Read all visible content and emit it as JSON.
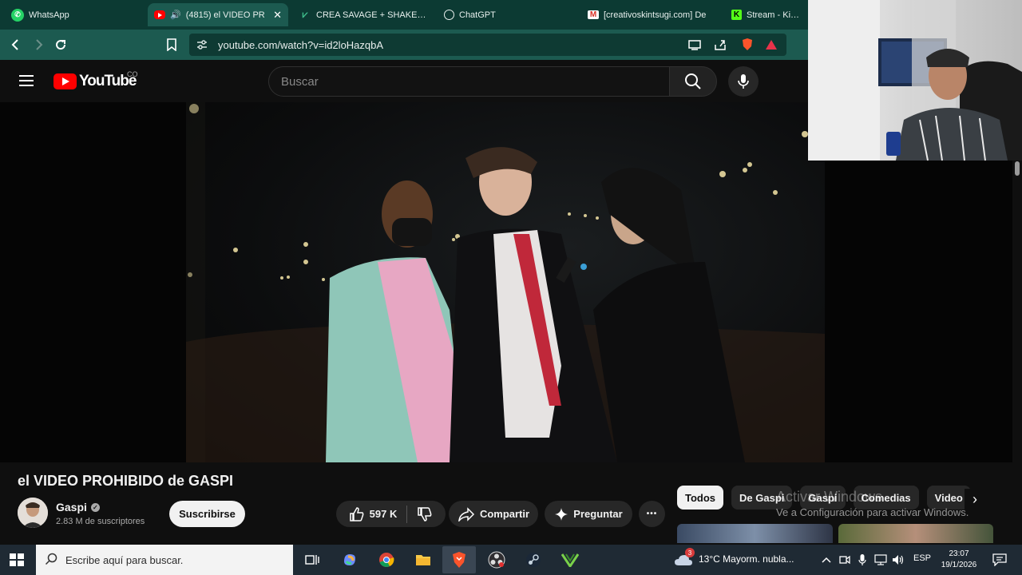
{
  "browser": {
    "tabs": [
      {
        "title": "WhatsApp",
        "icon": "whatsapp-icon",
        "active": false
      },
      {
        "title": "(4815) el VIDEO PR",
        "icon": "youtube-icon",
        "active": true,
        "audio": "speaker-icon",
        "close": "✕"
      },
      {
        "title": "CREA SAVAGE + SHAKER L",
        "icon": "vectorize-icon",
        "active": false
      },
      {
        "title": "ChatGPT",
        "icon": "chatgpt-icon",
        "active": false
      },
      {
        "title": "[creativoskintsugi.com] De",
        "icon": "gmail-icon",
        "active": false
      },
      {
        "title": "Stream - Kick D",
        "icon": "kick-icon",
        "active": false
      }
    ],
    "url": "youtube.com/watch?v=id2loHazqbA"
  },
  "youtube": {
    "logo_text": "YouTube",
    "country_code": "CO",
    "search_placeholder": "Buscar"
  },
  "video": {
    "title": "el VIDEO PROHIBIDO de GASPI",
    "channel": "Gaspi",
    "subscribers": "2.83 M de suscriptores",
    "subscribe_label": "Suscribirse",
    "likes": "597 K",
    "share_label": "Compartir",
    "ask_label": "Preguntar",
    "more_label": "•••"
  },
  "chips": [
    "Todos",
    "De Gaspi",
    "Gaspi",
    "Comedias",
    "Video"
  ],
  "watermark": {
    "line1": "Activar Windows",
    "line2": "Ve a Configuración para activar Windows."
  },
  "taskbar": {
    "search_placeholder": "Escribe aquí para buscar.",
    "weather": "13°C  Mayorm. nubla...",
    "language": "ESP",
    "time": "23:07",
    "date": "19/1/2026",
    "weather_badge": "3"
  },
  "colors": {
    "tab_bar": "#0c3a33",
    "address_bar": "#1c5a50",
    "youtube_red": "#ff0000",
    "page_bg": "#0f0f0f"
  }
}
